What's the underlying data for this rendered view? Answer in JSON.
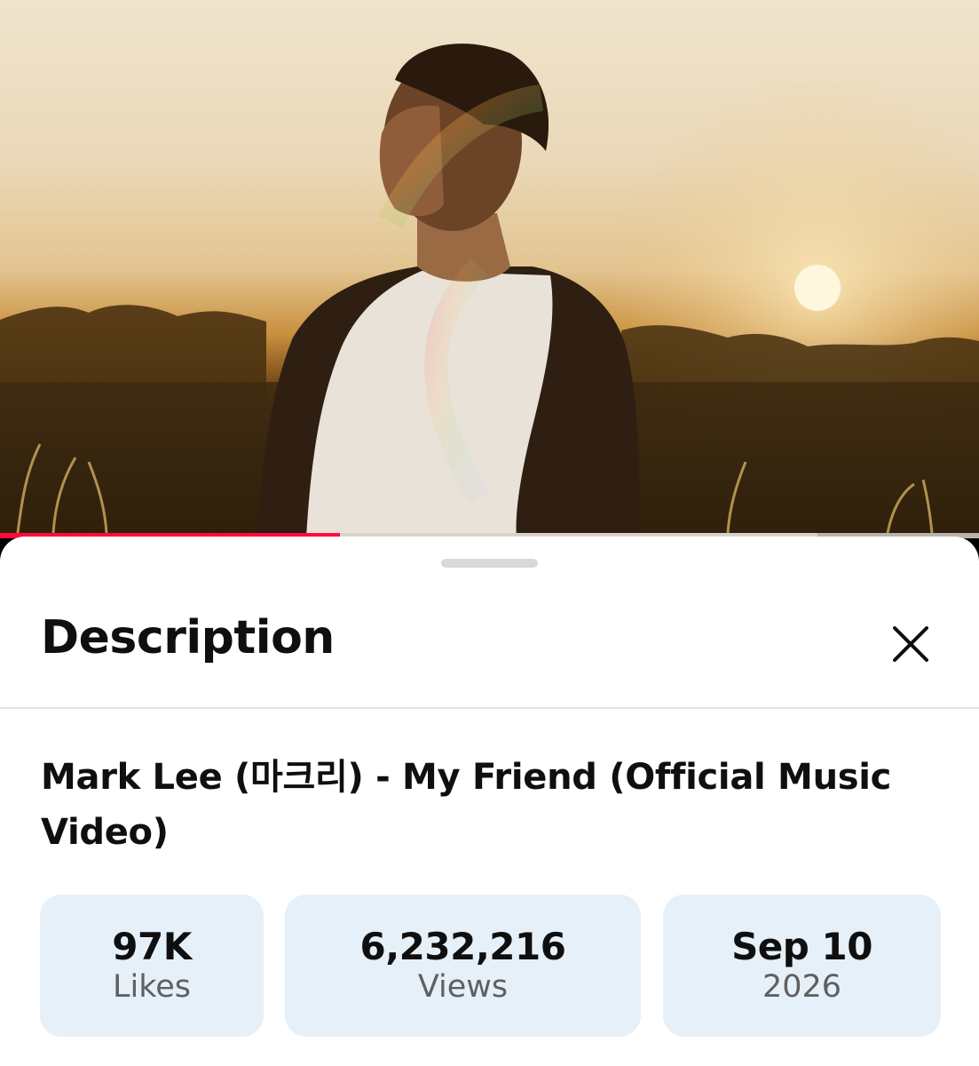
{
  "video": {
    "progress_fraction": 0.347,
    "buffered_fraction": 0.835,
    "progress_color": "#ff0a3c"
  },
  "sheet": {
    "title": "Description",
    "close_icon": "close-icon"
  },
  "details": {
    "title": "Mark Lee (마크리) - My Friend (Official Music Video)",
    "stats": {
      "likes_value": "97K",
      "likes_label": "Likes",
      "views_value": "6,232,216",
      "views_label": "Views",
      "date_value": "Sep 10",
      "date_label": "2026"
    }
  },
  "colors": {
    "stat_background": "#e6f0f8",
    "text_primary": "#0f0f0f",
    "text_secondary": "#606060"
  }
}
